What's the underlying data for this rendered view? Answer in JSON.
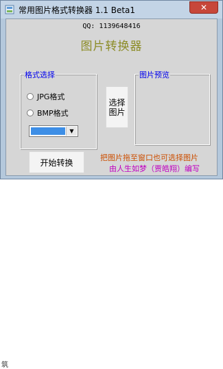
{
  "window": {
    "title": "常用图片格式转换器 1.1 Beta1",
    "close_label": "✕"
  },
  "header": {
    "qq": "QQ: 1139648416",
    "app_title": "图片转换器"
  },
  "format_group": {
    "label": "格式选择",
    "options": [
      "JPG格式",
      "BMP格式"
    ],
    "dropdown_arrow": "▼"
  },
  "buttons": {
    "choose_line1": "选择",
    "choose_line2": "图片",
    "start": "开始转换"
  },
  "preview_group": {
    "label": "图片预览"
  },
  "hints": {
    "drag": "把图片拖至窗口也可选择图片",
    "author": "由人生如梦（贾皓翔）编写"
  },
  "background": {
    "fragment": "筑"
  },
  "colors": {
    "title_accent": "#8c8c26",
    "group_label": "#0000ee",
    "hint_orange": "#cc4e00",
    "hint_magenta": "#c000c0",
    "close_red": "#c7473a"
  }
}
